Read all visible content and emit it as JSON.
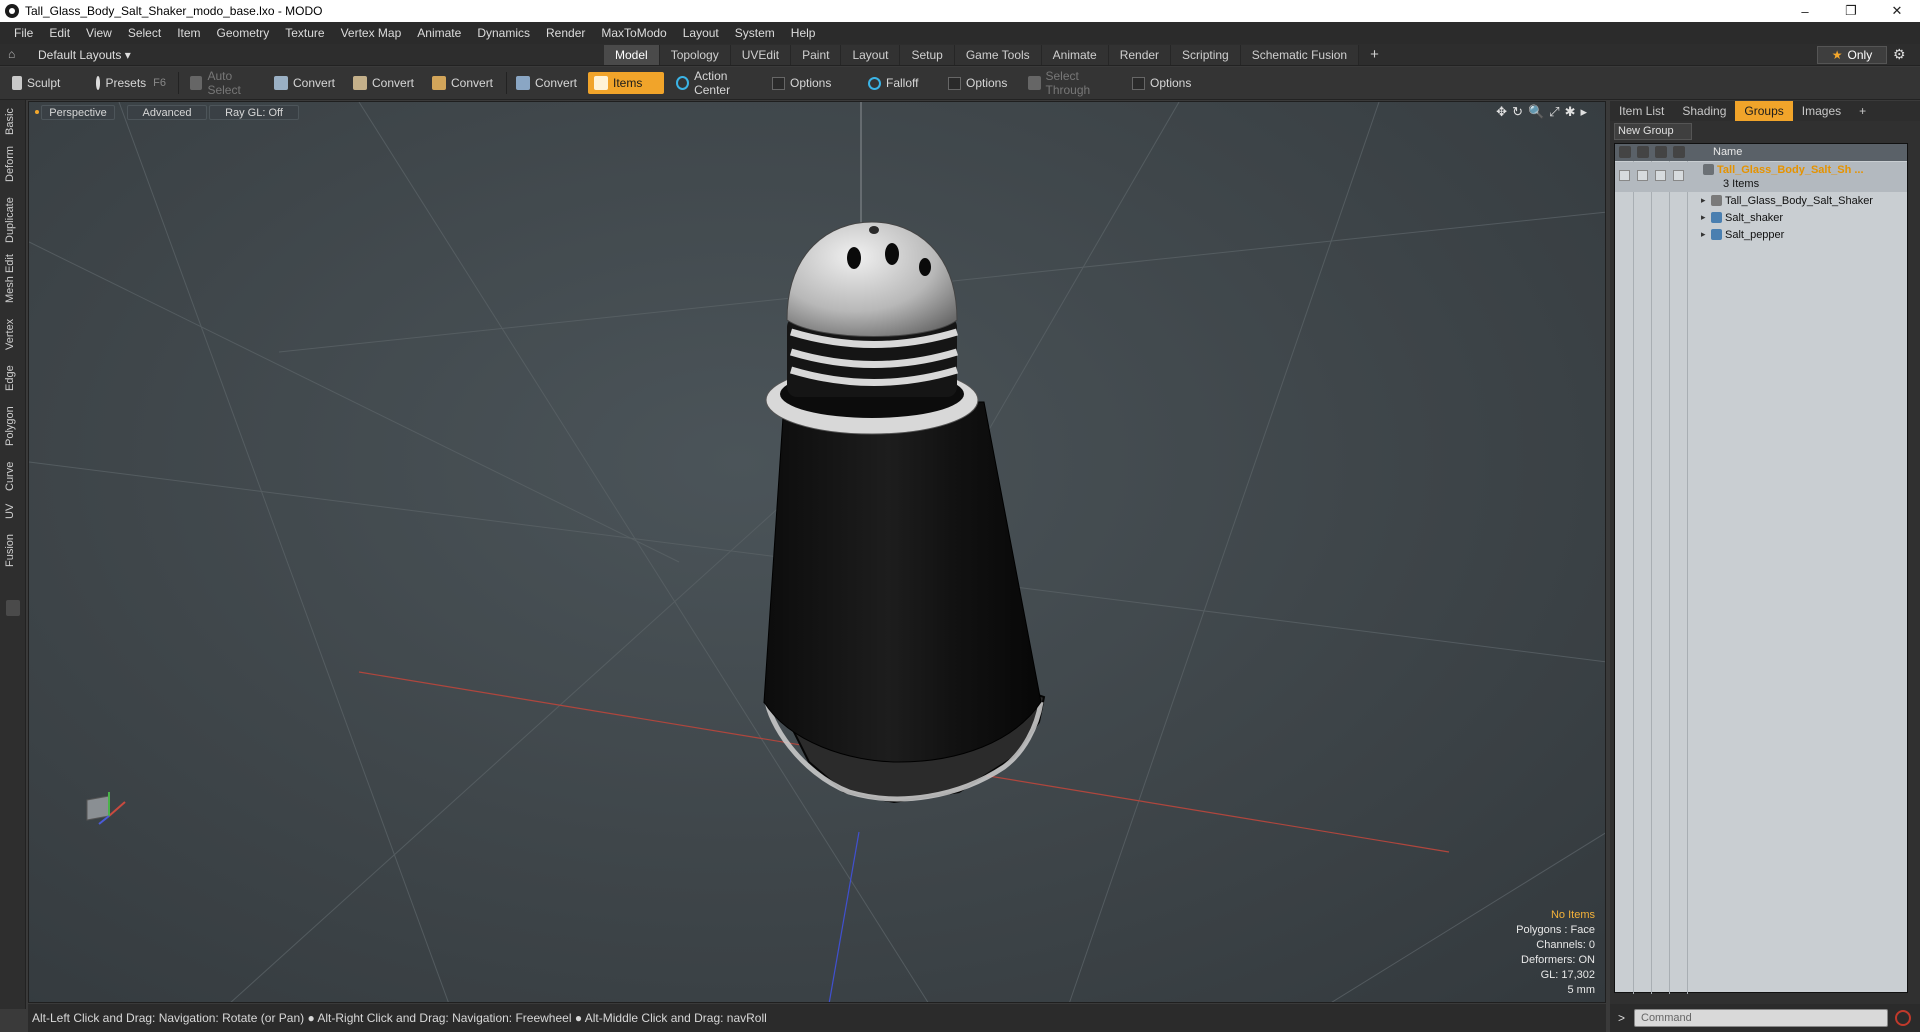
{
  "window": {
    "title": "Tall_Glass_Body_Salt_Shaker_modo_base.lxo - MODO",
    "controls": [
      "–",
      "❐",
      "✕"
    ]
  },
  "menu": [
    "File",
    "Edit",
    "View",
    "Select",
    "Item",
    "Geometry",
    "Texture",
    "Vertex Map",
    "Animate",
    "Dynamics",
    "Render",
    "MaxToModo",
    "Layout",
    "System",
    "Help"
  ],
  "layout_bar": {
    "layouts_label": "Default Layouts ▾",
    "tabs": [
      "Model",
      "Topology",
      "UVEdit",
      "Paint",
      "Layout",
      "Setup",
      "Game Tools",
      "Animate",
      "Render",
      "Scripting",
      "Schematic Fusion"
    ],
    "active_tab": "Model",
    "add_tab": "+",
    "only_label": "Only",
    "only_star": "★",
    "gear": "⚙"
  },
  "toolbar": {
    "sculpt": "Sculpt",
    "presets": "Presets",
    "presets_key": "F6",
    "auto_select": "Auto Select",
    "convert1": "Convert",
    "convert2": "Convert",
    "convert3": "Convert",
    "convert4": "Convert",
    "items": "Items",
    "action_center": "Action Center",
    "options1": "Options",
    "falloff": "Falloff",
    "options2": "Options",
    "select_through": "Select Through",
    "options3": "Options"
  },
  "side_tabs": [
    "Basic",
    "Deform",
    "Duplicate",
    "Mesh Edit",
    "Vertex",
    "Edge",
    "Polygon",
    "Curve",
    "UV",
    "Fusion"
  ],
  "viewport": {
    "view_mode": "Perspective",
    "shading": "Advanced",
    "raygl": "Ray GL: Off",
    "info": {
      "selection": "No Items",
      "polygons": "Polygons : Face",
      "channels": "Channels: 0",
      "deformers": "Deformers: ON",
      "gl": "GL: 17,302",
      "unit": "5 mm"
    },
    "icons": [
      "✥",
      "↻",
      "🔍",
      "⤢",
      "✱",
      "▸"
    ]
  },
  "statusbar": {
    "hint": "Alt-Left Click and Drag: Navigation: Rotate (or Pan) ● Alt-Right Click and Drag: Navigation: Freewheel ● Alt-Middle Click and Drag: navRoll"
  },
  "right_panel": {
    "tabs": [
      "Item List",
      "Shading",
      "Groups",
      "Images",
      "+"
    ],
    "active_tab": "Groups",
    "new_group": "New Group",
    "column_name": "Name",
    "group": {
      "name": "Tall_Glass_Body_Salt_Sh ...",
      "count": "3 Items",
      "children": [
        "Tall_Glass_Body_Salt_Shaker",
        "Salt_shaker",
        "Salt_pepper"
      ]
    }
  },
  "command": {
    "prompt": ">",
    "placeholder": "Command"
  },
  "colors": {
    "accent": "#f1a42a",
    "group_title": "#e59300",
    "axis_x": "#c0392b",
    "axis_z": "#3a4bd8"
  }
}
